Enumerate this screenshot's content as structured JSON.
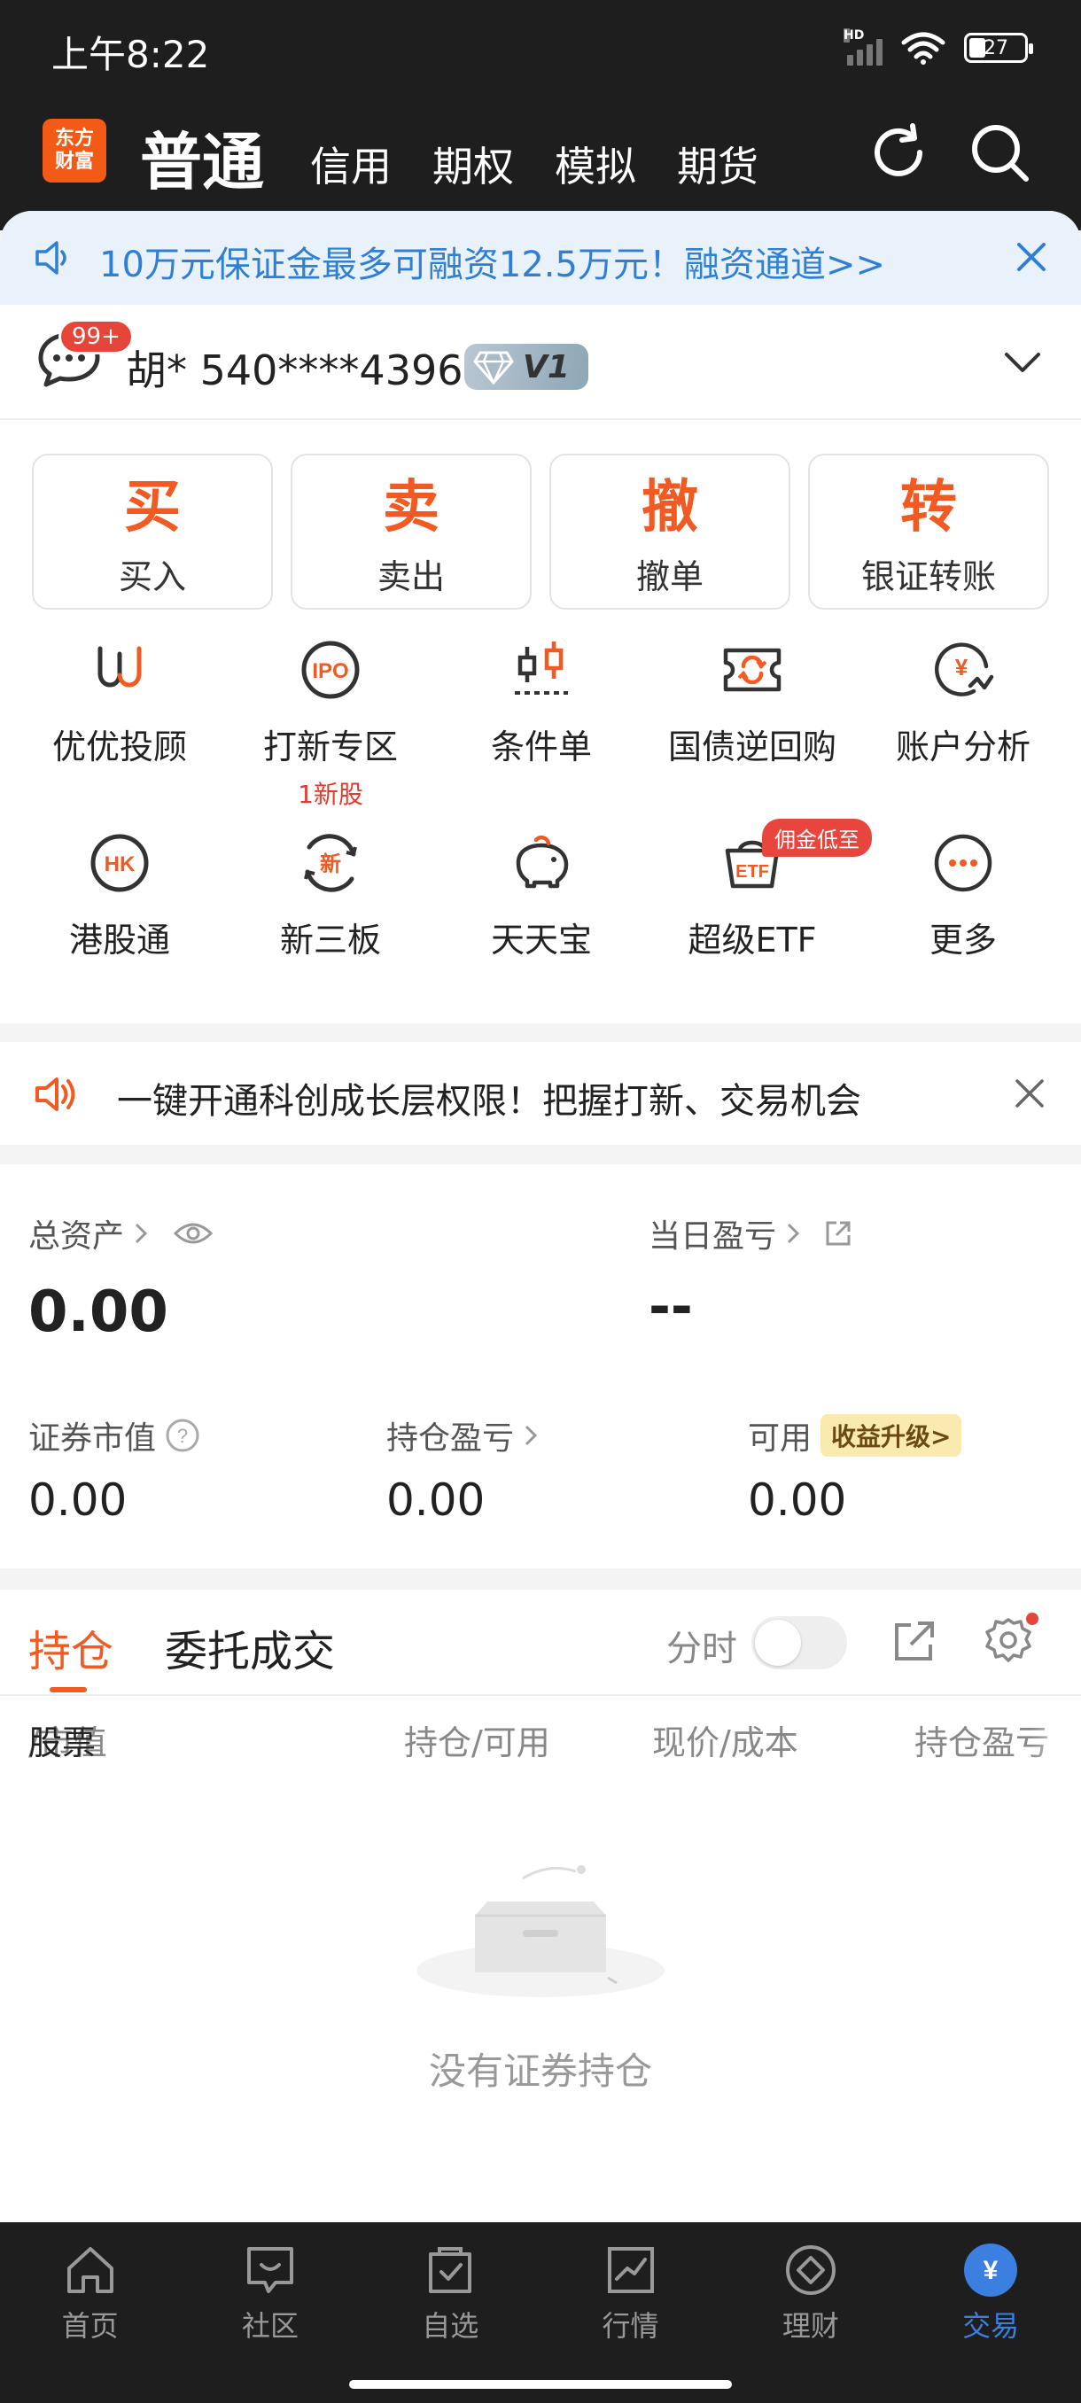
{
  "status_bar": {
    "time": "上午8:22",
    "battery": "27",
    "signal_label": "HD"
  },
  "logo": {
    "line1": "东方",
    "line2": "财富"
  },
  "top_nav": {
    "tabs": [
      {
        "label": "普通",
        "active": true
      },
      {
        "label": "信用"
      },
      {
        "label": "期权"
      },
      {
        "label": "模拟"
      },
      {
        "label": "期货"
      }
    ],
    "icons": [
      "refresh-icon",
      "search-icon"
    ]
  },
  "banner": {
    "text": "10万元保证金最多可融资12.5万元！融资通道>>"
  },
  "account": {
    "badge": "99+",
    "name": "胡* 540****4396",
    "level": "V1"
  },
  "trade_buttons": [
    {
      "big": "买",
      "label": "买入"
    },
    {
      "big": "卖",
      "label": "卖出"
    },
    {
      "big": "撤",
      "label": "撤单"
    },
    {
      "big": "转",
      "label": "银证转账"
    }
  ],
  "grid_row1": [
    {
      "label": "优优投顾",
      "icon": "uu-advisor-icon"
    },
    {
      "label": "打新专区",
      "icon": "ipo-icon",
      "sub": "1新股"
    },
    {
      "label": "条件单",
      "icon": "condition-order-icon"
    },
    {
      "label": "国债逆回购",
      "icon": "reverse-repo-icon"
    },
    {
      "label": "账户分析",
      "icon": "account-analysis-icon"
    }
  ],
  "grid_row2": [
    {
      "label": "港股通",
      "icon": "hk-icon",
      "icon_text": "HK"
    },
    {
      "label": "新三板",
      "icon": "neeq-icon",
      "icon_text": "新"
    },
    {
      "label": "天天宝",
      "icon": "piggy-bank-icon"
    },
    {
      "label": "超级ETF",
      "icon": "etf-icon",
      "icon_text": "ETF",
      "tag": "佣金低至"
    },
    {
      "label": "更多",
      "icon": "more-icon"
    }
  ],
  "notice": {
    "text": "一键开通科创成长层权限！把握打新、交易机会"
  },
  "assets": {
    "total_label": "总资产",
    "total_value": "0.00",
    "daily_label": "当日盈亏",
    "daily_value": "--",
    "securities_label": "证券市值",
    "securities_value": "0.00",
    "holding_label": "持仓盈亏",
    "holding_value": "0.00",
    "available_label": "可用",
    "available_value": "0.00",
    "upgrade_tag": "收益升级>"
  },
  "positions": {
    "tab_active": "持仓",
    "tab_other": "委托成交",
    "fenshi_label": "分时",
    "columns": [
      "股票",
      "/市值",
      "持仓/可用",
      "现价/成本",
      "持仓盈亏"
    ],
    "empty_text": "没有证券持仓"
  },
  "bottom_nav": [
    {
      "label": "首页",
      "icon": "home-icon"
    },
    {
      "label": "社区",
      "icon": "community-icon"
    },
    {
      "label": "自选",
      "icon": "watchlist-icon"
    },
    {
      "label": "行情",
      "icon": "market-icon"
    },
    {
      "label": "理财",
      "icon": "wealth-icon"
    },
    {
      "label": "交易",
      "icon": "trade-icon",
      "active": true,
      "icon_text": "¥"
    }
  ],
  "colors": {
    "accent": "#f15a22",
    "blue": "#3b7fe0",
    "dark": "#1e1e1e"
  }
}
